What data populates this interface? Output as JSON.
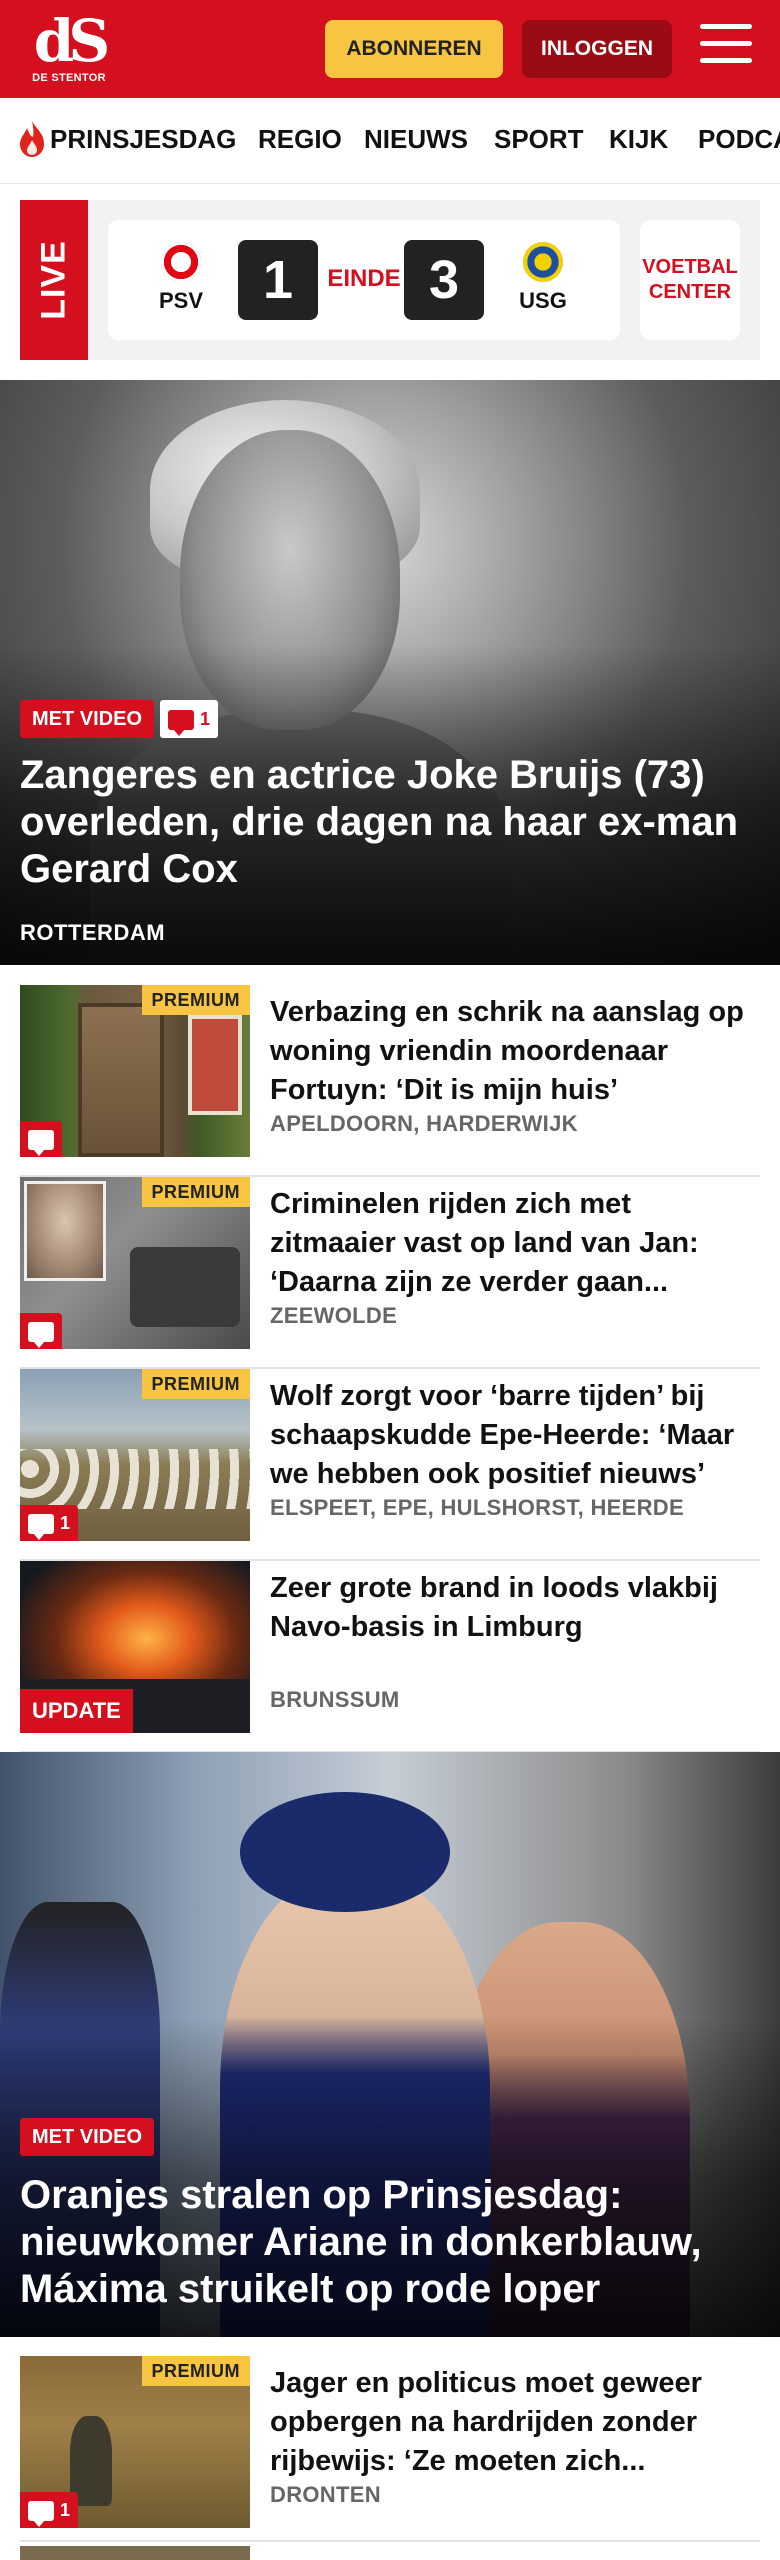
{
  "header": {
    "logo_mark": "dS",
    "logo_sub": "DE STENTOR",
    "subscribe_label": "ABONNEREN",
    "login_label": "INLOGGEN"
  },
  "nav": {
    "items": [
      "PRINSJESDAG",
      "REGIO",
      "NIEUWS",
      "SPORT",
      "KIJK",
      "PODCA"
    ]
  },
  "live": {
    "label": "LIVE",
    "home_team": "PSV",
    "away_team": "USG",
    "home_score": "1",
    "away_score": "3",
    "status": "EINDE",
    "voetbal_center": "VOETBAL CENTER"
  },
  "hero1": {
    "badge": "MET VIDEO",
    "comments": "1",
    "title": "Zangeres en actrice Joke Bruijs (73) overleden, drie dagen na haar ex-man Gerard Cox",
    "location": "ROTTERDAM"
  },
  "articles": [
    {
      "premium": "PREMIUM",
      "title": "Verbazing en schrik na aanslag op woning vriendin moordenaar Fortuyn: ‘Dit is mijn huis’",
      "location": "APELDOORN, HARDERWIJK",
      "comments": ""
    },
    {
      "premium": "PREMIUM",
      "title": "Criminelen rijden zich met zitmaaier vast op land van Jan: ‘Daarna zijn ze verder gaan...",
      "location": "ZEEWOLDE",
      "comments": ""
    },
    {
      "premium": "PREMIUM",
      "title": "Wolf zorgt voor ‘barre tijden’ bij schaapskudde Epe-Heerde: ‘Maar we hebben ook positief nieuws’",
      "location": "ELSPEET, EPE, HULSHORST, HEERDE",
      "comments": "1"
    },
    {
      "title": "Zeer grote brand in loods vlakbij Navo-basis in Limburg",
      "location": "BRUNSSUM",
      "update": "UPDATE"
    }
  ],
  "hero2": {
    "badge": "MET VIDEO",
    "title": "Oranjes stralen op Prinsjesdag: nieuwkomer Ariane in donkerblauw, Máxima struikelt op rode loper"
  },
  "article_after": {
    "premium": "PREMIUM",
    "title": "Jager en politicus moet geweer opbergen na hardrijden zonder rijbewijs: ‘Ze moeten zich...",
    "location": "DRONTEN",
    "comments": "1"
  },
  "colors": {
    "brand_red": "#d40f1e",
    "dark_red": "#9a0b16",
    "subscribe_yellow": "#f7c541",
    "premium_yellow": "#f7c541"
  }
}
